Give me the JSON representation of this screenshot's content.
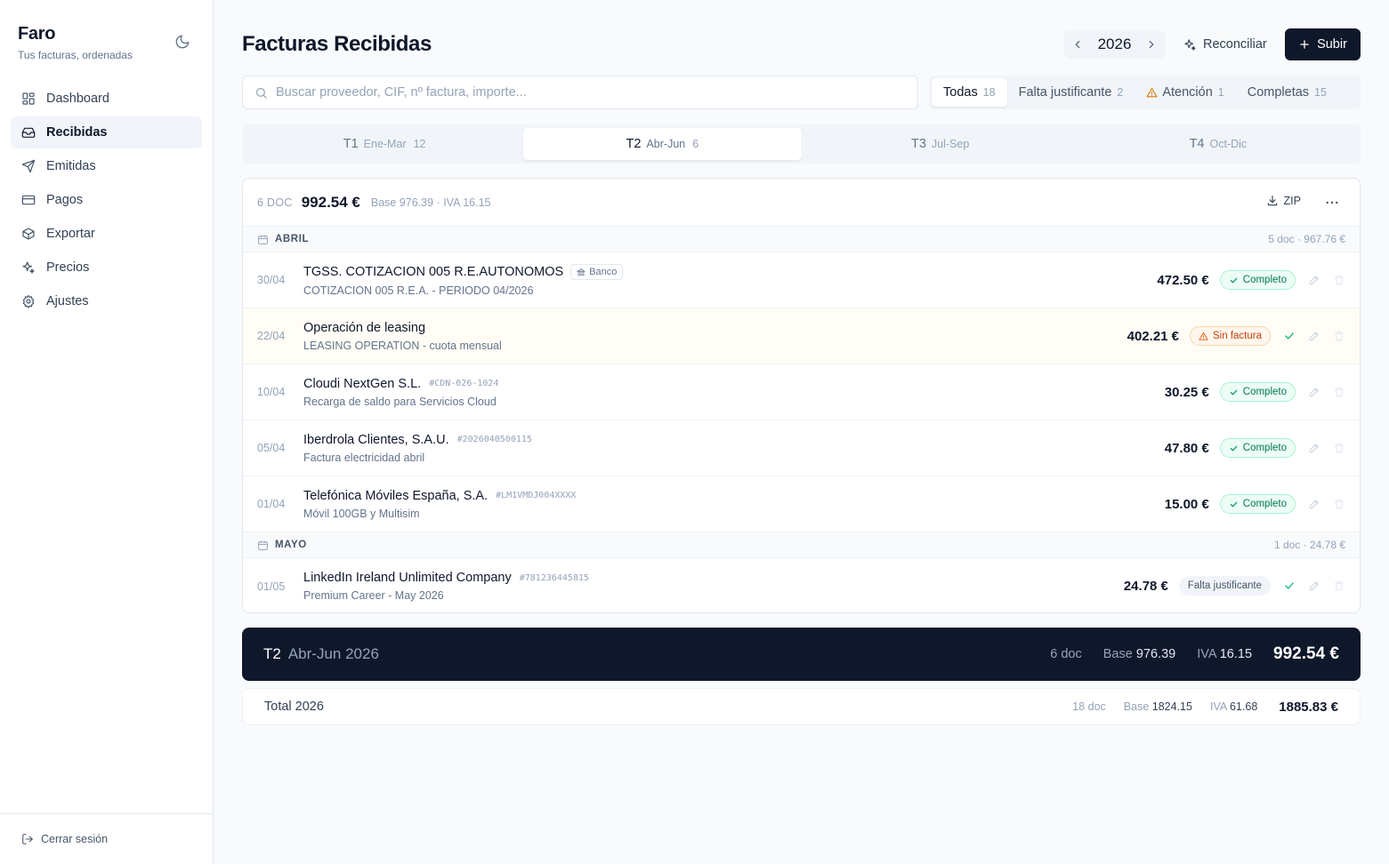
{
  "app": {
    "name": "Faro",
    "tagline": "Tus facturas, ordenadas"
  },
  "nav": [
    {
      "label": "Dashboard",
      "icon": "dashboard-icon",
      "active": false
    },
    {
      "label": "Recibidas",
      "icon": "inbox-icon",
      "active": true
    },
    {
      "label": "Emitidas",
      "icon": "send-icon",
      "active": false
    },
    {
      "label": "Pagos",
      "icon": "credit-card-icon",
      "active": false
    },
    {
      "label": "Exportar",
      "icon": "package-icon",
      "active": false
    },
    {
      "label": "Precios",
      "icon": "sparkles-icon",
      "active": false
    },
    {
      "label": "Ajustes",
      "icon": "gear-icon",
      "active": false
    }
  ],
  "logout_label": "Cerrar sesión",
  "header": {
    "title": "Facturas Recibidas",
    "year": "2026",
    "reconcile_label": "Reconciliar",
    "upload_label": "Subir"
  },
  "search": {
    "placeholder": "Buscar proveedor, CIF, nº factura, importe...",
    "value": ""
  },
  "filters": [
    {
      "label": "Todas",
      "count": "18",
      "active": true
    },
    {
      "label": "Falta justificante",
      "count": "2",
      "active": false
    },
    {
      "label": "Atención",
      "count": "1",
      "active": false,
      "icon": "warning-icon"
    },
    {
      "label": "Completas",
      "count": "15",
      "active": false
    }
  ],
  "quarters": [
    {
      "label": "T1",
      "range": "Ene-Mar",
      "count": "12",
      "active": false
    },
    {
      "label": "T2",
      "range": "Abr-Jun",
      "count": "6",
      "active": true
    },
    {
      "label": "T3",
      "range": "Jul-Sep",
      "count": "",
      "active": false
    },
    {
      "label": "T4",
      "range": "Oct-Dic",
      "count": "",
      "active": false
    }
  ],
  "card": {
    "doc_count": "6 DOC",
    "total": "992.54 €",
    "summary": "Base 976.39 · IVA 16.15",
    "zip_label": "ZIP"
  },
  "groups": [
    {
      "month": "ABRIL",
      "summary": "5 doc · 967.76 €",
      "rows": [
        {
          "date": "30/04",
          "vendor": "TGSS. COTIZACION 005 R.E.AUTONOMOS",
          "ref": "",
          "bank_label": "Banco",
          "description": "COTIZACION 005 R.E.A. - PERIODO 04/2026",
          "amount": "472.50 €",
          "status": "Completo",
          "status_type": "ok"
        },
        {
          "date": "22/04",
          "vendor": "Operación de leasing",
          "ref": "",
          "bank_label": "",
          "description": "LEASING OPERATION - cuota mensual",
          "amount": "402.21 €",
          "status": "Sin factura",
          "status_type": "warn"
        },
        {
          "date": "10/04",
          "vendor": "Cloudi NextGen S.L.",
          "ref": "#CDN-026-1024",
          "bank_label": "",
          "description": "Recarga de saldo para Servicios Cloud",
          "amount": "30.25 €",
          "status": "Completo",
          "status_type": "ok"
        },
        {
          "date": "05/04",
          "vendor": "Iberdrola Clientes, S.A.U.",
          "ref": "#2026040500115",
          "bank_label": "",
          "description": "Factura electricidad abril",
          "amount": "47.80 €",
          "status": "Completo",
          "status_type": "ok"
        },
        {
          "date": "01/04",
          "vendor": "Telefónica Móviles España, S.A.",
          "ref": "#LM1VMDJ004XXXX",
          "bank_label": "",
          "description": "Móvil 100GB y Multisim",
          "amount": "15.00 €",
          "status": "Completo",
          "status_type": "ok"
        }
      ]
    },
    {
      "month": "MAYO",
      "summary": "1 doc · 24.78 €",
      "rows": [
        {
          "date": "01/05",
          "vendor": "LinkedIn Ireland Unlimited Company",
          "ref": "#781236445815",
          "bank_label": "",
          "description": "Premium Career - May 2026",
          "amount": "24.78 €",
          "status": "Falta justificante",
          "status_type": "neutral"
        }
      ]
    }
  ],
  "quarter_summary": {
    "label": "T2",
    "period": "Abr-Jun 2026",
    "docs": "6 doc",
    "base_label": "Base",
    "base": "976.39",
    "iva_label": "IVA",
    "iva": "16.15",
    "total": "992.54 €"
  },
  "year_total": {
    "label": "Total 2026",
    "docs": "18 doc",
    "base_label": "Base",
    "base": "1824.15",
    "iva_label": "IVA",
    "iva": "61.68",
    "total": "1885.83 €"
  },
  "colors": {
    "primary": "#0f172a",
    "accent_ok": "#047857",
    "accent_warn": "#c2410c",
    "muted": "#94a3b8"
  }
}
